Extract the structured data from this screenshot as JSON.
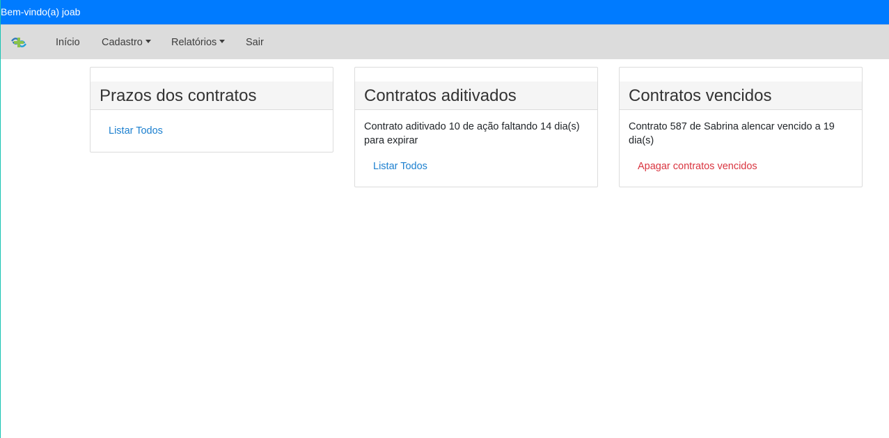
{
  "welcome": {
    "text": "Bem-vindo(a) joab"
  },
  "navbar": {
    "logo_icon": "app-logo-icon",
    "items": [
      {
        "label": "Início"
      },
      {
        "label": "Cadastro"
      },
      {
        "label": "Relatórios"
      },
      {
        "label": "Sair"
      }
    ]
  },
  "cards": [
    {
      "title": "Prazos dos contratos",
      "message": "",
      "link": "Listar Todos"
    },
    {
      "title": "Contratos aditivados",
      "message": "Contrato aditivado 10 de ação faltando 14 dia(s) para expirar",
      "link": "Listar Todos"
    },
    {
      "title": "Contratos vencidos",
      "message": "Contrato 587 de Sabrina alencar vencido a 19 dia(s)",
      "link": "Apagar contratos vencidos"
    }
  ],
  "colors": {
    "welcome_bar": "#007bff",
    "navbar": "#dcdcdc",
    "link": "#1b7fcf",
    "danger_link": "#d9343f"
  }
}
